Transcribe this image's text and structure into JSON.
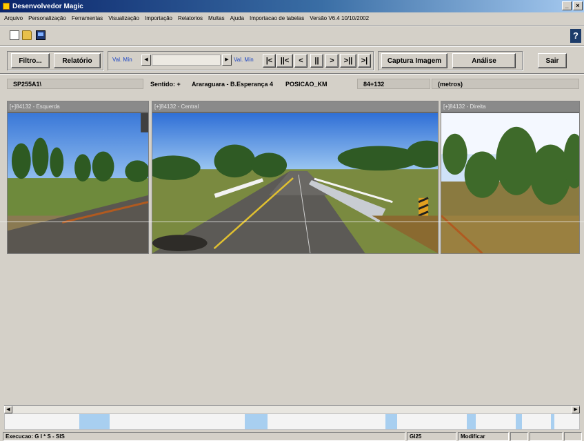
{
  "window": {
    "title": "Desenvolvedor Magic",
    "controls": [
      "_",
      "×"
    ]
  },
  "menu": [
    "Arquivo",
    "Personalização",
    "Ferramentas",
    "Visualização",
    "Importação",
    "Relatorios",
    "Multas",
    "Ajuda",
    "Importacao de tabelas",
    "Versão V6.4 10/10/2002"
  ],
  "toolbar": {
    "filtro": "Filtro...",
    "relatorio": "Relatório",
    "val_min_left": "Val. Mín",
    "val_min_right": "Val. Mín",
    "nav": [
      "|<",
      "||<",
      "<",
      "||",
      ">",
      ">||",
      ">|"
    ],
    "captura": "Captura Imagem",
    "analise": "Análise",
    "sair": "Sair",
    "icons": [
      "new-document-icon",
      "open-folder-icon",
      "computer-icon",
      "help-icon"
    ]
  },
  "info": {
    "rodovia": "SP255A1\\",
    "sentido": "Sentido: +",
    "trecho": "Araraguara - B.Esperança 4",
    "posicao_label": "POSICAO_KM",
    "posicao_value": "84+132",
    "unidade": "(metros)"
  },
  "panels": [
    {
      "label": "[+]84132 - Esquerda"
    },
    {
      "label": "[+]84132 - Central"
    },
    {
      "label": "[+]84132 - Direita"
    }
  ],
  "status": {
    "execucao": "Execucao: G I * S - SIS",
    "codigo": "GI25",
    "modo": "Modificar"
  },
  "colors": {
    "titlebar": "#0a246a",
    "timeline_segment": "#a8cff0",
    "label_blue": "#1a44c4"
  }
}
